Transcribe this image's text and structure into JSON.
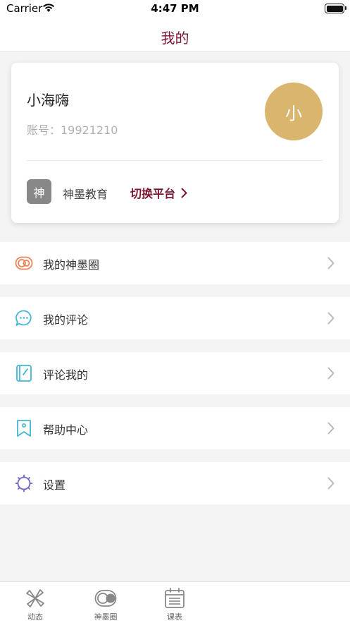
{
  "status_bar": {
    "carrier": "Carrier",
    "time": "4:47 PM"
  },
  "nav": {
    "title": "我的"
  },
  "profile": {
    "name": "小海嗨",
    "account": "账号：19921210",
    "avatar_text": "小",
    "org_badge": "神",
    "org_name": "神墨教育",
    "switch_label": "切换平台"
  },
  "menu": [
    {
      "label": "我的神墨圈",
      "icon": "circle-logo-icon"
    },
    {
      "label": "我的评论",
      "icon": "chat-bubble-icon"
    },
    {
      "label": "评论我的",
      "icon": "note-pen-icon"
    },
    {
      "label": "帮助中心",
      "icon": "bookmark-help-icon"
    },
    {
      "label": "设置",
      "icon": "gear-icon"
    }
  ],
  "tabs": [
    {
      "label": "动态",
      "icon": "windmill-icon"
    },
    {
      "label": "神墨圈",
      "icon": "toggle-circle-icon"
    },
    {
      "label": "课表",
      "icon": "calendar-icon"
    }
  ],
  "colors": {
    "accent": "#7a1630",
    "avatar": "#d9b56e",
    "badge": "#888888",
    "background": "#f4f4f5"
  }
}
